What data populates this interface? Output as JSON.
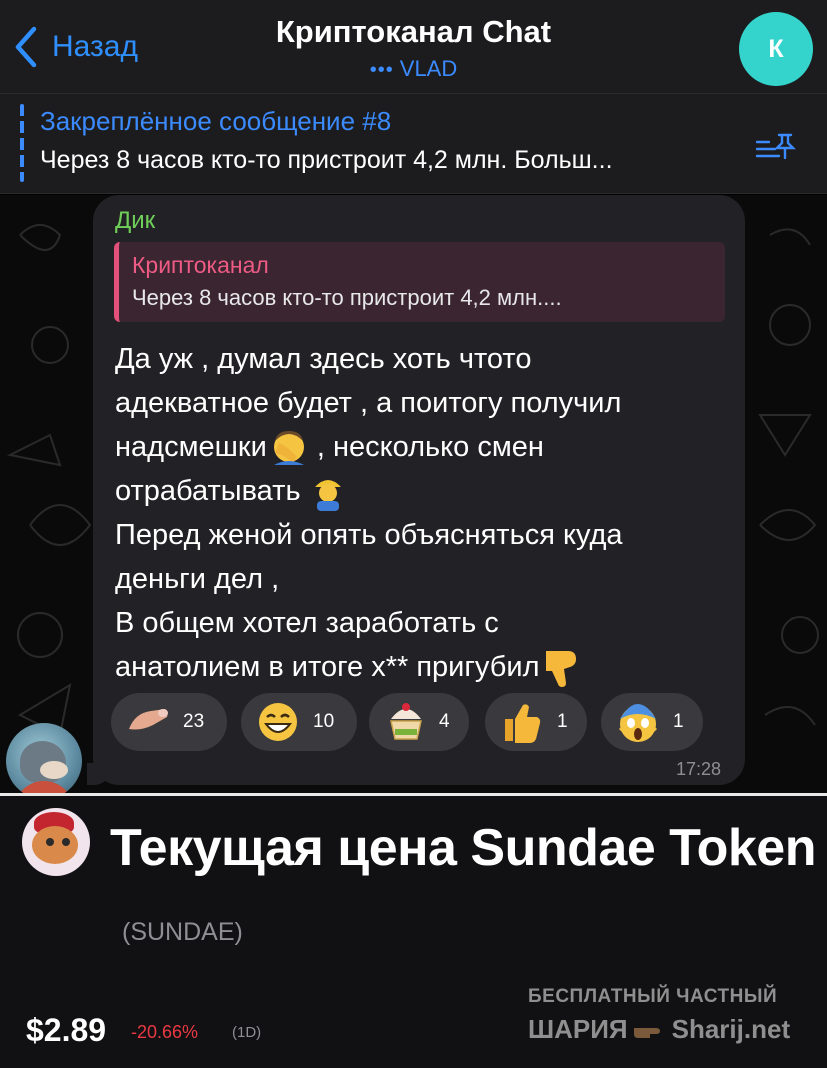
{
  "header": {
    "back_label": "Назад",
    "title": "Криптоканал Chat",
    "subtitle_dots": "•••",
    "subtitle": "VLAD",
    "avatar_letter": "К",
    "avatar_color": "#34d4cc"
  },
  "pinned": {
    "title": "Закреплённое сообщение #8",
    "text": "Через 8 часов кто-то пристроит 4,2 млн. Больш..."
  },
  "message": {
    "sender": "Дик",
    "reply_to": {
      "name": "Криптоканал",
      "text": "Через 8 часов кто-то пристроит 4,2 млн...."
    },
    "lines": [
      "Да уж , думал здесь хоть чтото",
      "адекватное будет , а поитогу получил",
      "надсмешки",
      " , несколько смен",
      "отрабатывать",
      "Перед женой опять объясняться куда",
      "деньги дел ,",
      "В общем хотел заработать с",
      "анатолием в итоге х** пригубил"
    ],
    "inline_emojis": [
      "facepalm-emoji",
      "construction-worker-emoji",
      "thumbs-down-emoji"
    ],
    "reactions": [
      {
        "icon": "finger-emoji",
        "count": "23"
      },
      {
        "icon": "grinning-face-emoji",
        "count": "10"
      },
      {
        "icon": "ice-cream-sundae-emoji",
        "count": "4"
      },
      {
        "icon": "thumbs-up-emoji",
        "count": "1"
      },
      {
        "icon": "screaming-face-emoji",
        "count": "1"
      }
    ],
    "time": "17:28"
  },
  "price": {
    "title": "Текущая цена Sundae Token",
    "ticker": "(SUNDAE)",
    "value": "$2.89",
    "change": "-20.66%",
    "period": "(1D)",
    "change_color": "#ea3943"
  },
  "watermark": {
    "line1": "БЕСПЛАТНЫЙ ЧАСТНЫЙ",
    "line2a": "ШАРИЯ",
    "line2b": "Sharij.net"
  },
  "colors": {
    "accent": "#2f8fff",
    "sender": "#6fcf59",
    "reply": "#ee5b84"
  }
}
